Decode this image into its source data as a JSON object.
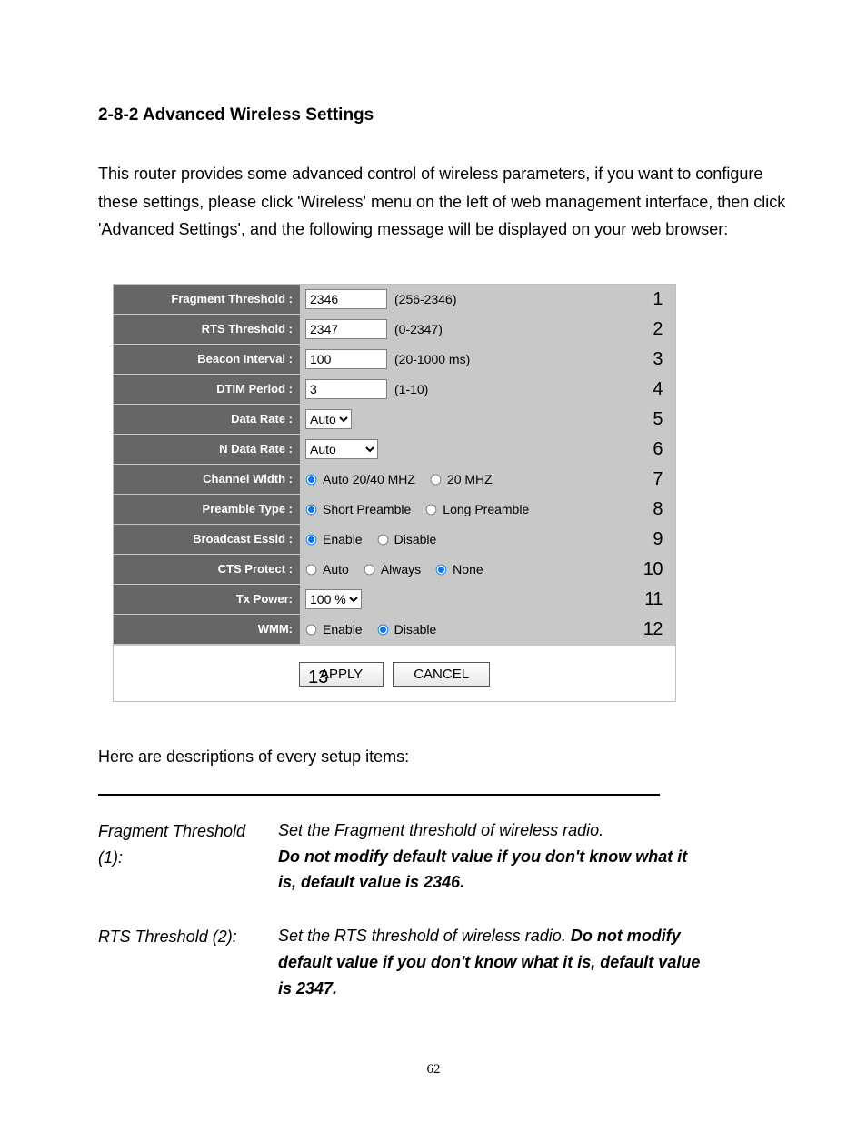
{
  "section_title": "2-8-2 Advanced Wireless Settings",
  "intro": "This router provides some advanced control of wireless parameters, if you want to configure these settings, please click 'Wireless' menu on the left of web management interface, then click 'Advanced Settings', and the following message will be displayed on your web browser:",
  "rows": {
    "fragment": {
      "label": "Fragment Threshold :",
      "value": "2346",
      "range": "(256-2346)",
      "num": "1"
    },
    "rts": {
      "label": "RTS Threshold :",
      "value": "2347",
      "range": "(0-2347)",
      "num": "2"
    },
    "beacon": {
      "label": "Beacon Interval :",
      "value": "100",
      "range": "(20-1000 ms)",
      "num": "3"
    },
    "dtim": {
      "label": "DTIM Period :",
      "value": "3",
      "range": "(1-10)",
      "num": "4"
    },
    "datarate": {
      "label": "Data Rate :",
      "value": "Auto",
      "num": "5"
    },
    "ndatarate": {
      "label": "N Data Rate :",
      "value": "Auto",
      "num": "6"
    },
    "chanwidth": {
      "label": "Channel Width :",
      "opt1": "Auto 20/40 MHZ",
      "opt2": "20 MHZ",
      "num": "7"
    },
    "preamble": {
      "label": "Preamble Type :",
      "opt1": "Short Preamble",
      "opt2": "Long Preamble",
      "num": "8"
    },
    "bcast": {
      "label": "Broadcast Essid :",
      "opt1": "Enable",
      "opt2": "Disable",
      "num": "9"
    },
    "cts": {
      "label": "CTS Protect :",
      "opt1": "Auto",
      "opt2": "Always",
      "opt3": "None",
      "num": "10"
    },
    "txpower": {
      "label": "Tx Power:",
      "value": "100 %",
      "num": "11"
    },
    "wmm": {
      "label": "WMM:",
      "opt1": "Enable",
      "opt2": "Disable",
      "num": "12"
    }
  },
  "buttons": {
    "apply": "APPLY",
    "cancel": "CANCEL",
    "num": "13"
  },
  "desc_intro": "Here are descriptions of every setup items:",
  "defs": {
    "fragment": {
      "term": "Fragment Threshold (1):",
      "line1": "Set the Fragment threshold of wireless radio.",
      "bold": "Do not modify default value if you don't know what it is, default value is 2346."
    },
    "rts": {
      "term": "RTS Threshold (2):",
      "line1": "Set the RTS threshold of wireless radio. ",
      "bold": "Do not modify default value if you don't know what it is, default value is 2347."
    }
  },
  "page_number": "62"
}
